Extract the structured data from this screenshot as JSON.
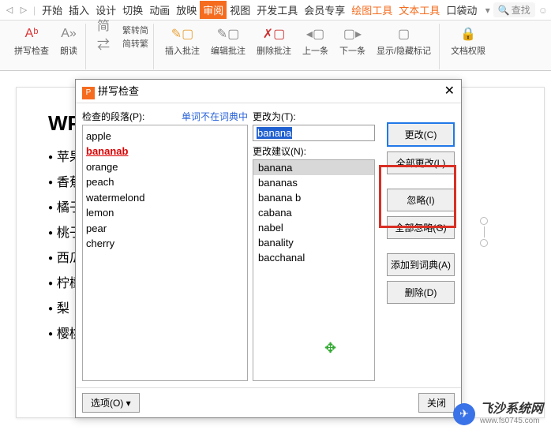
{
  "menubar": {
    "items": [
      "开始",
      "插入",
      "设计",
      "切换",
      "动画",
      "放映",
      "审阅",
      "视图",
      "开发工具",
      "会员专享",
      "绘图工具",
      "文本工具",
      "口袋动"
    ],
    "active_index": 6,
    "orange_indices": [
      10,
      11
    ],
    "search": "查找"
  },
  "toolbar": {
    "spellcheck": {
      "label": "拼写检查",
      "drop": "▾"
    },
    "read": {
      "label": "朗读",
      "drop": "▾"
    },
    "conv": {
      "a": "繁转简",
      "b": "简转繁"
    },
    "insert_comment": "插入批注",
    "edit_comment": "编辑批注",
    "delete_comment": "删除批注",
    "prev": "上一条",
    "next": "下一条",
    "showhide": "显示/隐藏标记",
    "perm": "文档权限"
  },
  "document": {
    "title": "WP",
    "items": [
      "苹果",
      "香蕉",
      "橘子",
      "桃子",
      "西瓜",
      "柠檬",
      "梨",
      "樱桃"
    ]
  },
  "dialog": {
    "title": "拼写检查",
    "para_label": "检查的段落(P):",
    "not_in_dict": "单词不在词典中",
    "change_to_label": "更改为(T):",
    "change_to_value": "banana",
    "suggest_label": "更改建议(N):",
    "words": [
      {
        "text": "apple"
      },
      {
        "text": "bananab",
        "err": true
      },
      {
        "text": "orange"
      },
      {
        "text": "peach"
      },
      {
        "text": "watermelond"
      },
      {
        "text": "lemon"
      },
      {
        "text": "pear"
      },
      {
        "text": "cherry"
      }
    ],
    "suggestions": [
      "banana",
      "bananas",
      "banana b",
      "cabana",
      "nabel",
      "banality",
      "bacchanal"
    ],
    "selected_suggestion": 0,
    "btn_change": "更改(C)",
    "btn_change_all": "全部更改(L)",
    "btn_ignore": "忽略(I)",
    "btn_ignore_all": "全部忽略(G)",
    "btn_add": "添加到词典(A)",
    "btn_delete": "删除(D)",
    "options": "选项(O) ▾",
    "close": "关闭"
  },
  "watermark": {
    "name": "飞沙系统网",
    "url": "www.fs0745.com"
  }
}
